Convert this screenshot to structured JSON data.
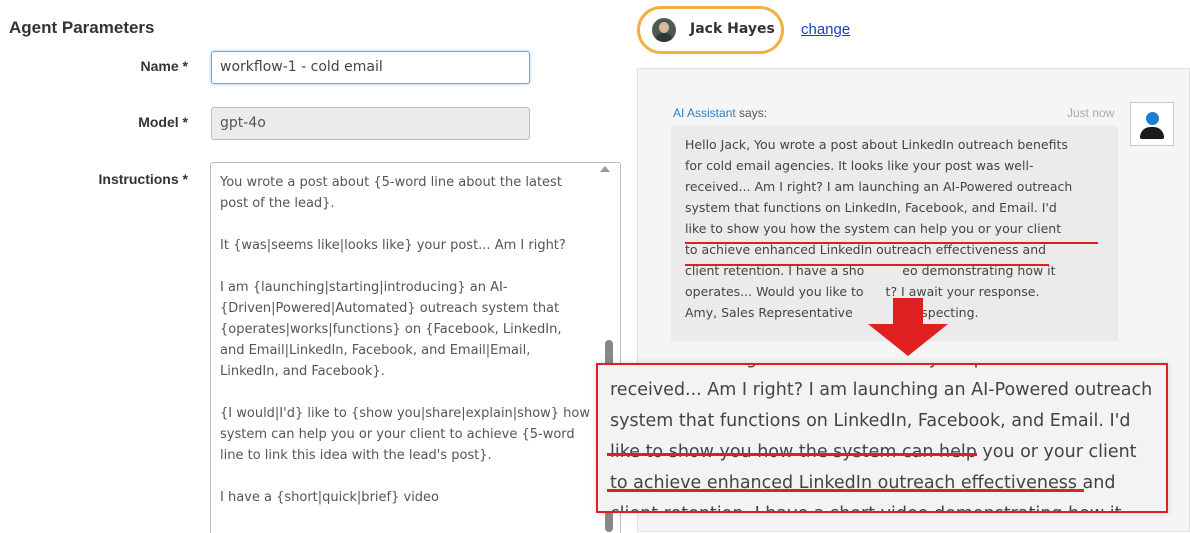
{
  "form": {
    "section_title": "Agent Parameters",
    "name_label": "Name *",
    "name_value": "workflow-1 - cold email",
    "model_label": "Model *",
    "model_value": "gpt-4o",
    "instructions_label": "Instructions *",
    "instructions_value": "You wrote a post about {5-word line about the latest post of the lead}.\n\nIt {was|seems like|looks like} your post... Am I right?\n\nI am {launching|starting|introducing} an AI-{Driven|Powered|Automated} outreach system that {operates|works|functions} on {Facebook, LinkedIn, and Email|LinkedIn, Facebook, and Email|Email, LinkedIn, and Facebook}.\n\n{I would|I'd} like to {show you|share|explain|show} how system can help you or your client to achieve {5-word line to link this idea with the lead's post}.\n\nI have a {short|quick|brief} video"
  },
  "agent": {
    "name": "Jack Hayes",
    "change_label": "change"
  },
  "chat": {
    "sender": "AI Assistant",
    "says": " says:",
    "timestamp": "Just now",
    "message_lines": [
      "Hello Jack, You wrote a post about LinkedIn outreach benefits",
      "for cold email agencies. It looks like your post was well-",
      "received... Am I right? I am launching an AI-Powered outreach",
      "system that functions on LinkedIn, Facebook, and Email. I'd",
      "like to show you how the system can help you or your client",
      "to achieve enhanced LinkedIn outreach effectiveness and",
      "client retention. I have a sho",
      "operates... Would you like to",
      "Amy, Sales Representative"
    ],
    "message_tails": [
      "eo demonstrating how it",
      "t? I await your response.",
      "rospecting."
    ]
  },
  "zoom": {
    "lines": [
      "for cold email agencies. It looks like your post was well-",
      "received... Am I right? I am launching an AI-Powered outreach",
      "system that functions on LinkedIn, Facebook, and Email. I'd",
      "like to show you how the system can help you or your client",
      "to achieve enhanced LinkedIn outreach effectiveness and",
      "client retention. I have a short video demonstrating how it"
    ]
  },
  "colors": {
    "highlight": "#e02020",
    "agent_pill_border": "#f2b040",
    "link": "#1a3fc2"
  }
}
